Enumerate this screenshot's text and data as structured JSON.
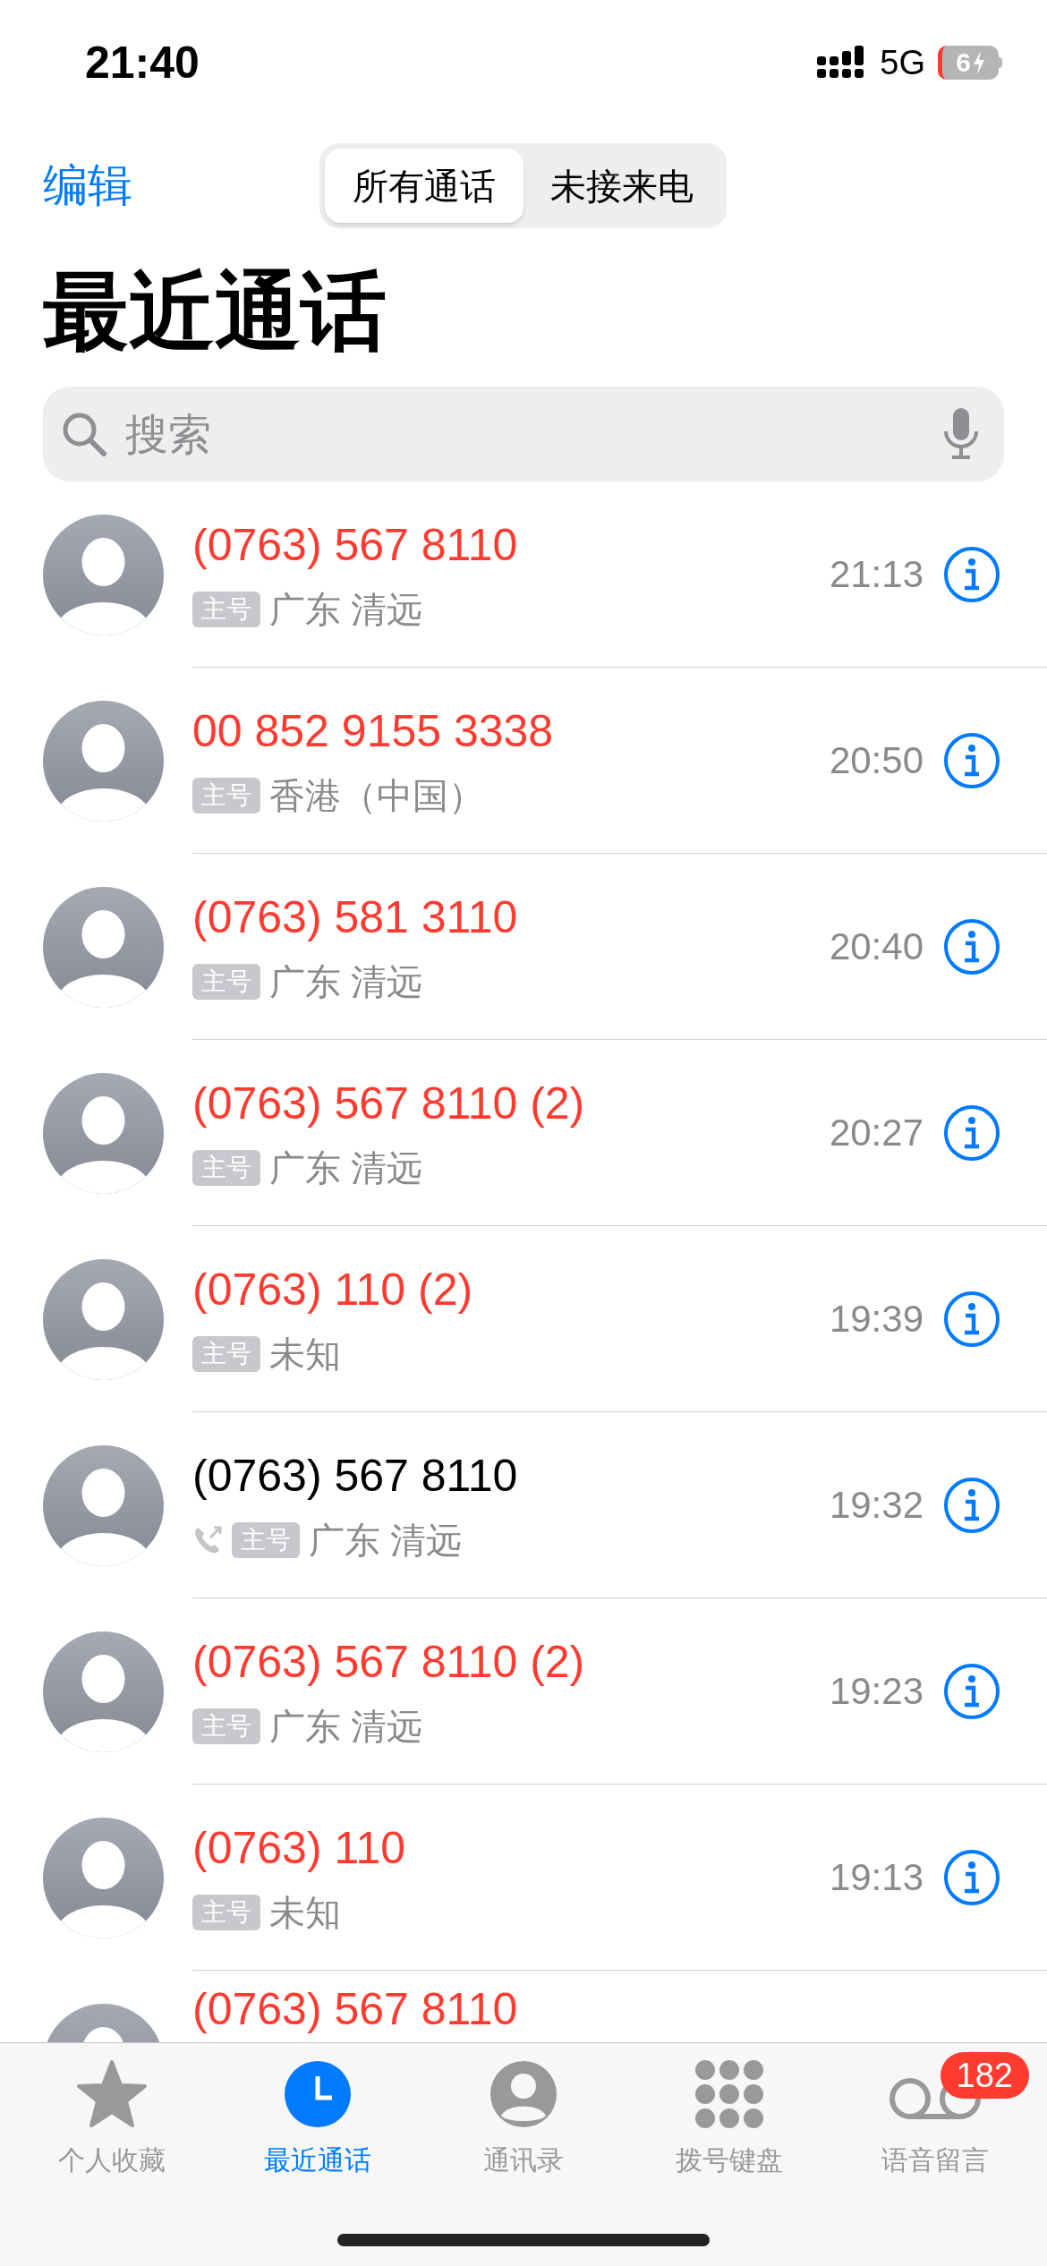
{
  "status_bar": {
    "time": "21:40",
    "network": "5G",
    "battery": "6"
  },
  "header": {
    "edit": "编辑",
    "segments": [
      {
        "label": "所有通话",
        "selected": true
      },
      {
        "label": "未接来电",
        "selected": false
      }
    ]
  },
  "title": "最近通话",
  "search": {
    "placeholder": "搜索"
  },
  "calls": [
    {
      "name": "(0763) 567 8110",
      "missed": true,
      "badge": "主号",
      "location": "广东 清远",
      "time": "21:13"
    },
    {
      "name": "00 852 9155 3338",
      "missed": true,
      "badge": "主号",
      "location": "香港（中国）",
      "time": "20:50"
    },
    {
      "name": "(0763) 581 3110",
      "missed": true,
      "badge": "主号",
      "location": "广东 清远",
      "time": "20:40"
    },
    {
      "name": "(0763) 567 8110 (2)",
      "missed": true,
      "badge": "主号",
      "location": "广东 清远",
      "time": "20:27"
    },
    {
      "name": "(0763) 110 (2)",
      "missed": true,
      "badge": "主号",
      "location": "未知",
      "time": "19:39"
    },
    {
      "name": "(0763) 567 8110",
      "missed": false,
      "outgoing": true,
      "badge": "主号",
      "location": "广东 清远",
      "time": "19:32"
    },
    {
      "name": "(0763) 567 8110 (2)",
      "missed": true,
      "badge": "主号",
      "location": "广东 清远",
      "time": "19:23"
    },
    {
      "name": "(0763) 110",
      "missed": true,
      "badge": "主号",
      "location": "未知",
      "time": "19:13"
    },
    {
      "name": "(0763) 567 8110",
      "missed": true
    }
  ],
  "tab_bar": [
    {
      "kind": "favorites",
      "label": "个人收藏",
      "selected": false
    },
    {
      "kind": "recents",
      "label": "最近通话",
      "selected": true
    },
    {
      "kind": "contacts",
      "label": "通讯录",
      "selected": false
    },
    {
      "kind": "keypad",
      "label": "拨号键盘",
      "selected": false
    },
    {
      "kind": "voicemail",
      "label": "语音留言",
      "selected": false,
      "badge": "182"
    }
  ]
}
